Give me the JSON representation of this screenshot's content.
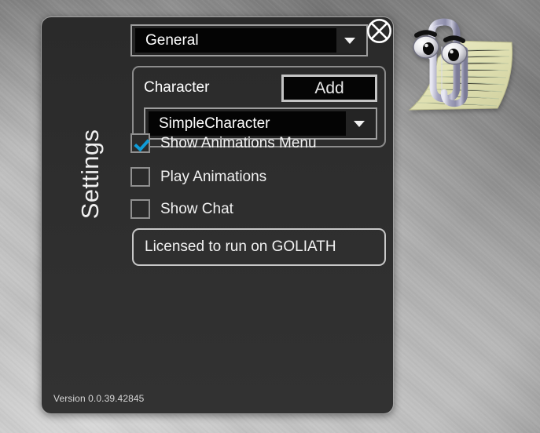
{
  "window": {
    "panel_title": "Settings",
    "version": "Version 0.0.39.42845",
    "close_icon": "close-circle-x-icon"
  },
  "section_combo": {
    "value": "General",
    "caret_icon": "chevron-down-icon",
    "options": [
      "General"
    ]
  },
  "character_group": {
    "label": "Character",
    "add_label": "Add",
    "combo": {
      "value": "SimpleCharacter",
      "caret_icon": "chevron-down-icon",
      "options": [
        "SimpleCharacter"
      ]
    }
  },
  "checkboxes": [
    {
      "label": "Show Animations Menu",
      "checked": true
    },
    {
      "label": "Play Animations",
      "checked": false
    },
    {
      "label": "Show Chat",
      "checked": false
    }
  ],
  "license": {
    "text": "Licensed to run on GOLIATH"
  },
  "assistant": {
    "name": "clippy-paperclip-assistant"
  },
  "colors": {
    "panel_bg": "#2e2e2e",
    "panel_border": "#ebebeb",
    "field_bg": "#040404",
    "control_border": "#9d9d9d",
    "text": "#f2f2f2",
    "checkmark_blue": "#0f9cd8",
    "desktop_metal": "#bdbdbd"
  }
}
